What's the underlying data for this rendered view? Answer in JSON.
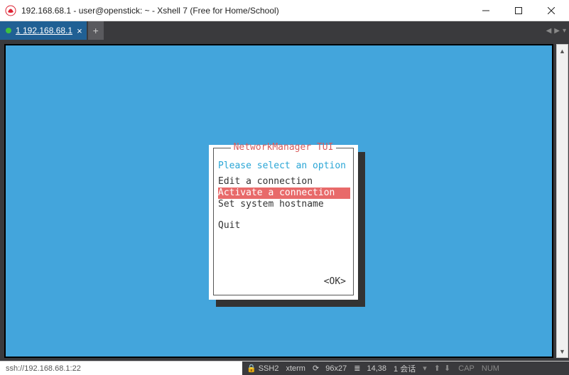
{
  "window": {
    "title": "192.168.68.1 - user@openstick: ~ - Xshell 7 (Free for Home/School)"
  },
  "tabs": {
    "active": {
      "label": "1 192.168.68.1"
    }
  },
  "tui": {
    "title": "NetworkManager TUI",
    "prompt": "Please select an option",
    "items": [
      "Edit a connection",
      "Activate a connection",
      "Set system hostname"
    ],
    "selected_index": 1,
    "quit": "Quit",
    "ok": "<OK>"
  },
  "status": {
    "left": "ssh://192.168.68.1:22",
    "proto": "SSH2",
    "term": "xterm",
    "size": "96x27",
    "cursor": "14,38",
    "sessions": "1 会话",
    "arrows": "⬆  ⬇",
    "cap": "CAP",
    "num": "NUM"
  }
}
